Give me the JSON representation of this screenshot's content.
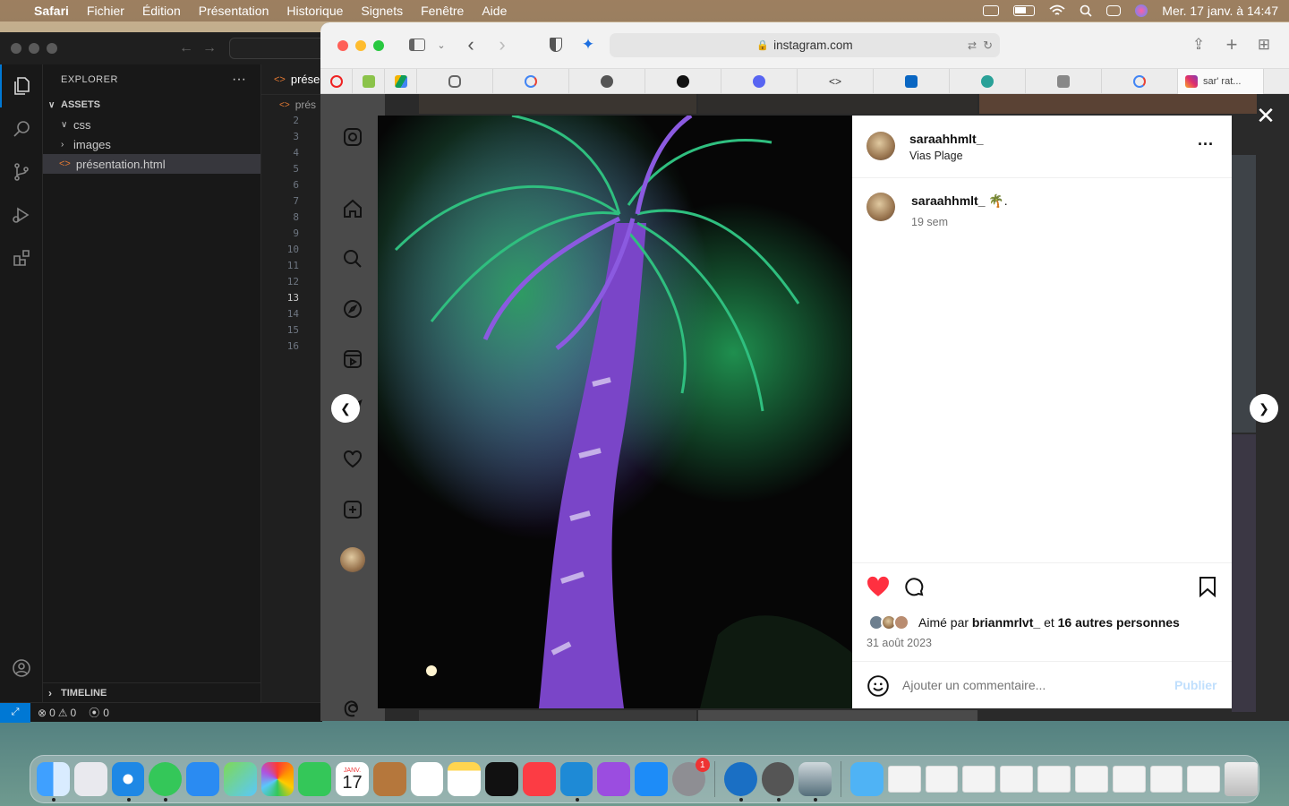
{
  "menubar": {
    "app": "Safari",
    "menus": [
      "Fichier",
      "Édition",
      "Présentation",
      "Historique",
      "Signets",
      "Fenêtre",
      "Aide"
    ],
    "datetime": "Mer. 17 janv. à 14:47"
  },
  "vscode": {
    "explorer_title": "EXPLORER",
    "root_folder": "ASSETS",
    "tree": [
      {
        "label": "css",
        "kind": "folder",
        "expanded": true
      },
      {
        "label": "images",
        "kind": "folder",
        "expanded": false
      },
      {
        "label": "présentation.html",
        "kind": "file",
        "selected": true
      }
    ],
    "timeline": "TIMELINE",
    "tab": "prése",
    "breadcrumb": "prés",
    "line_numbers": [
      "2",
      "3",
      "4",
      "5",
      "6",
      "7",
      "8",
      "9",
      "10",
      "11",
      "12",
      "13",
      "14",
      "15",
      "16"
    ],
    "current_line": "13",
    "status": {
      "errors": "0",
      "warnings": "0",
      "ports": "0"
    }
  },
  "safari": {
    "url": "instagram.com",
    "active_tab_title": "sar' rat..."
  },
  "instagram": {
    "username": "saraahhmlt_",
    "location": "Vias Plage",
    "caption": "🌴.",
    "time_ago": "19 sem",
    "liked_by_prefix": "Aimé par",
    "liked_by_user": "brianmrlvt_",
    "liked_by_and": "et",
    "liked_by_others": "16 autres personnes",
    "date": "31 août 2023",
    "comment_placeholder": "Ajouter un commentaire...",
    "publish_label": "Publier",
    "accent_like": "#ff3040",
    "accent_link": "#c0dffd"
  },
  "dock": {
    "calendar_month": "JANV.",
    "calendar_day": "17",
    "settings_badge": "1"
  }
}
